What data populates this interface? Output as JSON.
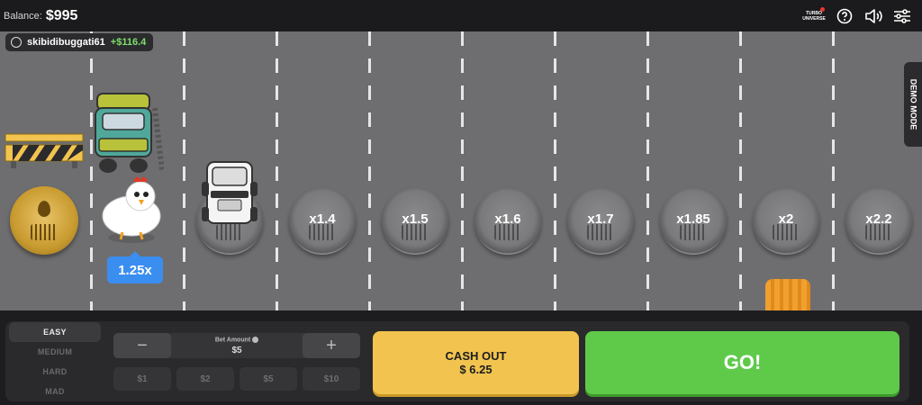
{
  "header": {
    "balance_label": "Balance:",
    "balance_value": "$995",
    "icons": [
      "turbo-universe-logo",
      "help-icon",
      "sound-icon",
      "settings-sliders-icon"
    ],
    "logo_text": "TURBO UNIVERSE"
  },
  "player": {
    "username": "skibidibuggati61",
    "winnings": "+$116.4"
  },
  "demo_mode_label": "DEMO MODE",
  "road": {
    "current_multiplier": "1.25x",
    "lanes": [
      {
        "multiplier": "x1.4"
      },
      {
        "multiplier": "x1.5"
      },
      {
        "multiplier": "x1.6"
      },
      {
        "multiplier": "x1.7"
      },
      {
        "multiplier": "x1.85"
      },
      {
        "multiplier": "x2"
      },
      {
        "multiplier": "x2.2"
      }
    ]
  },
  "difficulty": {
    "options": [
      "EASY",
      "MEDIUM",
      "HARD",
      "MAD"
    ],
    "selected": "EASY"
  },
  "bet": {
    "label": "Bet Amount",
    "value": "$5",
    "minus": "−",
    "plus": "+",
    "quick_chips": [
      "$1",
      "$2",
      "$5",
      "$10"
    ]
  },
  "actions": {
    "cashout_label": "CASH OUT",
    "cashout_amount": "$ 6.25",
    "go_label": "GO!"
  },
  "colors": {
    "road": "#6e6e70",
    "cashout": "#f2c44f",
    "go": "#5fca4a",
    "badge": "#3a8ef0",
    "win": "#7ee06a"
  }
}
